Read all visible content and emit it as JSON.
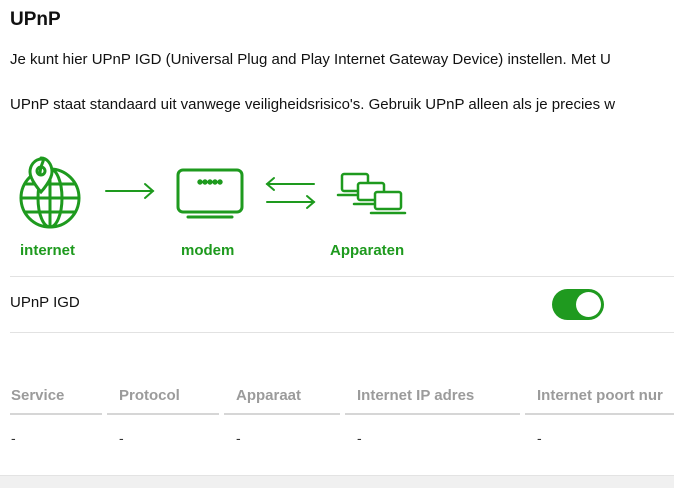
{
  "page": {
    "title": "UPnP",
    "paragraph1": "Je kunt hier UPnP IGD (Universal Plug and Play Internet Gateway Device) instellen. Met U",
    "paragraph2": "UPnP staat standaard uit vanwege veiligheidsrisico's. Gebruik UPnP alleen als je precies w"
  },
  "diagram": {
    "internet_label": "internet",
    "modem_label": "modem",
    "devices_label": "Apparaten",
    "icon_color": "#1e9a1e"
  },
  "upnp": {
    "label": "UPnP IGD",
    "enabled": true,
    "toggle_color": "#1f9a1f"
  },
  "table": {
    "headers": [
      "Service",
      "Protocol",
      "Apparaat",
      "Internet IP adres",
      "Internet poort nur"
    ],
    "rows": [
      [
        "-",
        "-",
        "-",
        "-",
        "-"
      ]
    ]
  }
}
